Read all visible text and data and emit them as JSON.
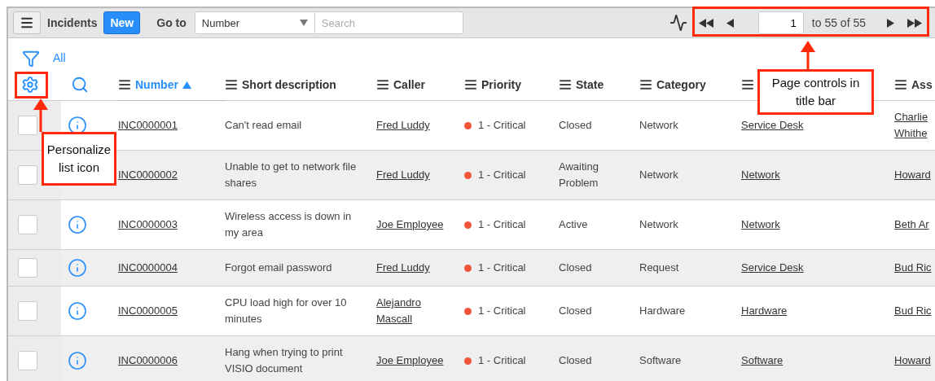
{
  "title_bar": {
    "title": "Incidents",
    "new_button": "New",
    "goto_label": "Go to",
    "goto_field": "Number",
    "search": {
      "placeholder": "Search"
    },
    "pager": {
      "page_field": "1",
      "range": "to 55 of 55"
    }
  },
  "filter": {
    "label": "All"
  },
  "table": {
    "columns": [
      {
        "label": "Number",
        "sorted": true
      },
      {
        "label": "Short description",
        "sorted": false
      },
      {
        "label": "Caller",
        "sorted": false
      },
      {
        "label": "Priority",
        "sorted": false
      },
      {
        "label": "State",
        "sorted": false
      },
      {
        "label": "Category",
        "sorted": false
      },
      {
        "sorted": false
      },
      {
        "label": "Ass",
        "sorted": false
      }
    ],
    "rows": [
      {
        "checked": false,
        "info_icon": true,
        "number": "INC0000001",
        "short_description": "Can't read email",
        "caller": "Fred Luddy",
        "priority": "1 - Critical",
        "state": "Closed",
        "category": "Network",
        "assignment_group": "Service Desk",
        "assigned_to": "Charlie Whithe"
      },
      {
        "checked": false,
        "info_icon": false,
        "number": "INC0000002",
        "short_description": "Unable to get to network file shares",
        "caller": "Fred Luddy",
        "priority": "1 - Critical",
        "state": "Awaiting Problem",
        "category": "Network",
        "assignment_group": "Network",
        "assigned_to": "Howard"
      },
      {
        "checked": false,
        "info_icon": true,
        "number": "INC0000003",
        "short_description": "Wireless access is down in my area",
        "caller": "Joe Employee",
        "priority": "1 - Critical",
        "state": "Active",
        "category": "Network",
        "assignment_group": "Network",
        "assigned_to": "Beth Ar"
      },
      {
        "checked": false,
        "info_icon": true,
        "number": "INC0000004",
        "short_description": "Forgot email password",
        "caller": "Fred Luddy",
        "priority": "1 - Critical",
        "state": "Closed",
        "category": "Request",
        "assignment_group": "Service Desk",
        "assigned_to": "Bud Ric"
      },
      {
        "checked": false,
        "info_icon": true,
        "number": "INC0000005",
        "short_description": "CPU load high for over 10 minutes",
        "caller": "Alejandro Mascall",
        "priority": "1 - Critical",
        "state": "Closed",
        "category": "Hardware",
        "assignment_group": "Hardware",
        "assigned_to": "Bud Ric"
      },
      {
        "checked": false,
        "info_icon": true,
        "number": "INC0000006",
        "short_description": "Hang when trying to print VISIO document",
        "caller": "Joe Employee",
        "priority": "1 - Critical",
        "state": "Closed",
        "category": "Software",
        "assignment_group": "Software",
        "assigned_to": "Howard"
      }
    ]
  },
  "annotations": [
    {
      "text": "Personalize list icon"
    },
    {
      "text": "Page controls in title bar"
    }
  ]
}
